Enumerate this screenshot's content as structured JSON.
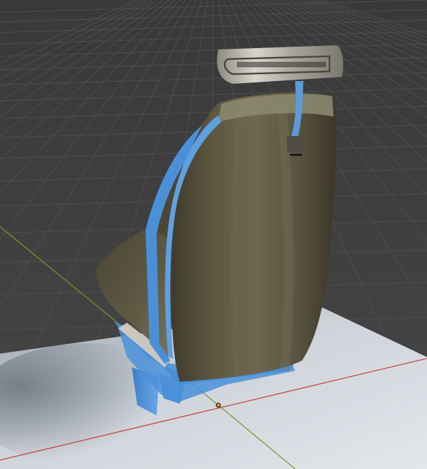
{
  "viewport": {
    "mode": "3d-viewport",
    "background_color": "#3d3d3d",
    "grid_line_color": "#4d4d4d",
    "x_axis_color": "#c94040",
    "y_axis_color": "#6e9a2c",
    "floor_color": "#d9dde3"
  },
  "object": {
    "kind": "seat",
    "material_color": "#5e5a45",
    "highlight_color": "#4a90d9",
    "origin_marker_color": "#f5a623"
  },
  "icons": [
    "origin-icon"
  ]
}
